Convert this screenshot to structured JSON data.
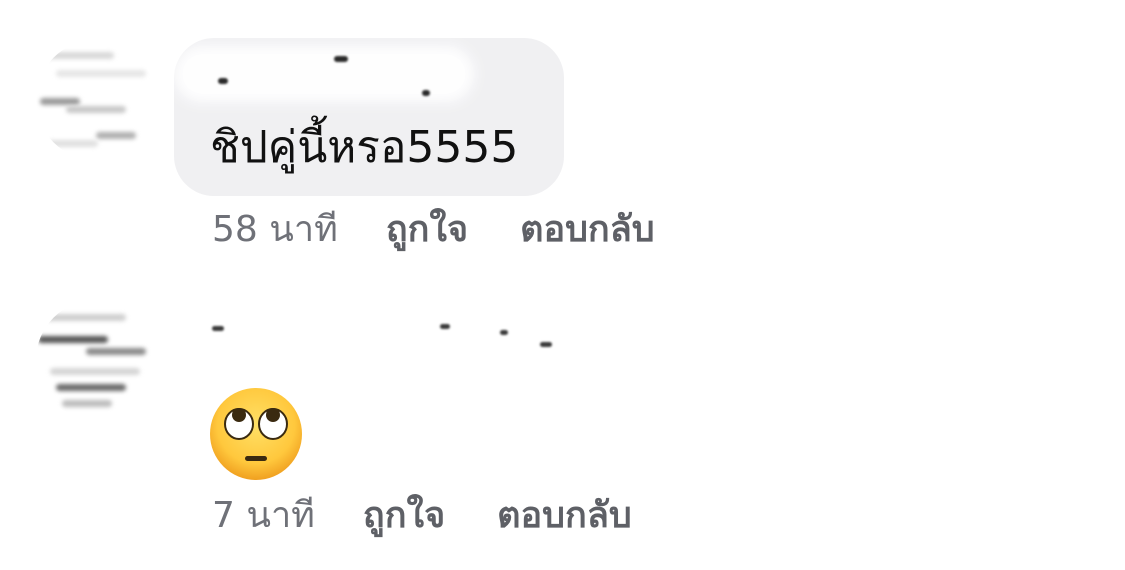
{
  "comments": [
    {
      "text": "ชิปคู่นี้หรอ5555",
      "time": "58 นาที",
      "like_label": "ถูกใจ",
      "reply_label": "ตอบกลับ"
    },
    {
      "emoji_name": "face-with-rolling-eyes-icon",
      "time": "7 นาที",
      "like_label": "ถูกใจ",
      "reply_label": "ตอบกลับ"
    }
  ],
  "colors": {
    "bubble_background": "#f0f0f2",
    "meta_text": "#6f7178",
    "comment_text": "#111111"
  }
}
